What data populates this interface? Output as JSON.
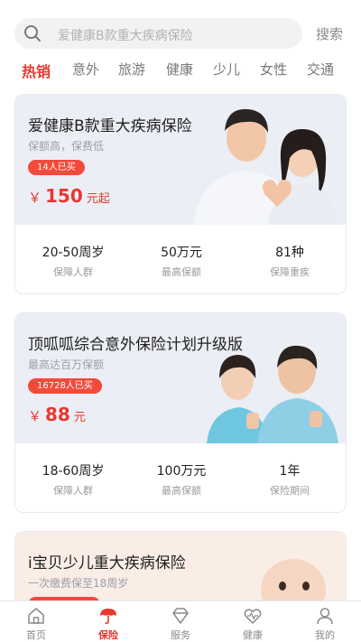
{
  "search": {
    "placeholder": "爱健康B款重大疾病保险",
    "button_label": "搜索"
  },
  "tabs": [
    {
      "label": "热销",
      "active": true
    },
    {
      "label": "意外"
    },
    {
      "label": "旅游"
    },
    {
      "label": "健康"
    },
    {
      "label": "少儿"
    },
    {
      "label": "女性"
    },
    {
      "label": "交通"
    }
  ],
  "products": [
    {
      "title": "爱健康B款重大疾病保险",
      "subtitle": "保额高，保费低",
      "badge": "14人已买",
      "price_prefix": "￥",
      "price": "150",
      "price_unit": "元起",
      "stats": [
        {
          "value": "20-50周岁",
          "label": "保障人群"
        },
        {
          "value": "50万元",
          "label": "最高保额"
        },
        {
          "value": "81种",
          "label": "保障重疾"
        }
      ]
    },
    {
      "title": "顶呱呱综合意外保险计划升级版",
      "subtitle": "最高达百万保额",
      "badge": "16728人已买",
      "price_prefix": "￥",
      "price": "88",
      "price_unit": "元",
      "stats": [
        {
          "value": "18-60周岁",
          "label": "保障人群"
        },
        {
          "value": "100万元",
          "label": "最高保额"
        },
        {
          "value": "1年",
          "label": "保险期间"
        }
      ]
    },
    {
      "title": "i宝贝少儿重大疾病保险",
      "subtitle": "一次缴费保至18周岁"
    }
  ],
  "nav": [
    {
      "label": "首页",
      "icon": "home-icon"
    },
    {
      "label": "保险",
      "icon": "umbrella-icon",
      "active": true
    },
    {
      "label": "服务",
      "icon": "diamond-icon"
    },
    {
      "label": "健康",
      "icon": "heart-icon"
    },
    {
      "label": "我的",
      "icon": "user-icon"
    }
  ],
  "colors": {
    "accent": "#e8382f",
    "card_bg": "#eceef5",
    "card3_bg": "#f9ede6"
  }
}
